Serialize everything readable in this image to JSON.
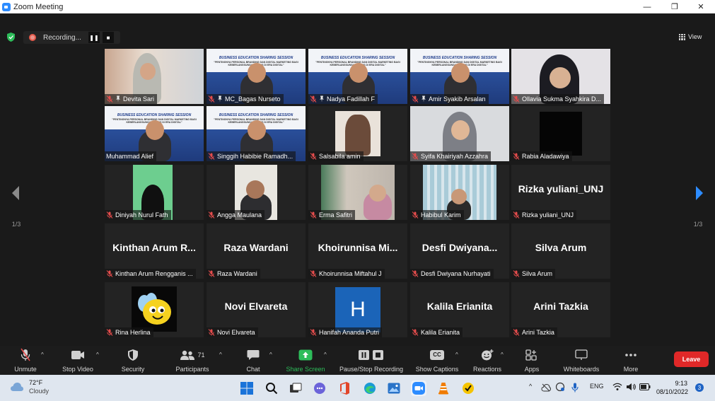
{
  "window": {
    "title": "Zoom Meeting",
    "controls": {
      "minimize": "—",
      "maximize": "❐",
      "close": "✕"
    }
  },
  "recording": {
    "status": "Recording...",
    "pause": "❚❚",
    "stop": "■"
  },
  "view_button": {
    "label": "View"
  },
  "pagination": {
    "left_label": "1/3",
    "right_label": "1/3"
  },
  "participants": [
    {
      "name": "Devita Sari",
      "display": "",
      "muted": true,
      "pinned": true,
      "video": "photo-hijab"
    },
    {
      "name": "MC_Bagas Nurseto",
      "display": "",
      "muted": true,
      "pinned": true,
      "video": "slide"
    },
    {
      "name": "Nadya Fadillah F",
      "display": "",
      "muted": true,
      "pinned": true,
      "video": "slide"
    },
    {
      "name": "Amir Syakib Arsalan",
      "display": "",
      "muted": true,
      "pinned": true,
      "video": "slide"
    },
    {
      "name": "Ollavia Sukma Syahkira D...",
      "display": "",
      "muted": true,
      "pinned": false,
      "video": "photo-hijab-black"
    },
    {
      "name": "Muhammad Alief",
      "display": "",
      "muted": false,
      "pinned": false,
      "video": "slide",
      "active": true
    },
    {
      "name": "Singgih Habibie Ramadh...",
      "display": "",
      "muted": true,
      "pinned": false,
      "video": "slide"
    },
    {
      "name": "Salsabila amin",
      "display": "",
      "muted": true,
      "pinned": false,
      "video": "anime"
    },
    {
      "name": "Syifa Khairiyah Azzahra",
      "display": "",
      "muted": true,
      "pinned": false,
      "video": "photo-hijab-grey"
    },
    {
      "name": "Rabia Aladawiya",
      "display": "",
      "muted": true,
      "pinned": false,
      "video": "black"
    },
    {
      "name": "Diniyah Nurul Fath",
      "display": "",
      "muted": true,
      "pinned": false,
      "video": "green"
    },
    {
      "name": "Angga Maulana",
      "display": "",
      "muted": true,
      "pinned": false,
      "video": "photo-boy"
    },
    {
      "name": "Erma Safitri",
      "display": "",
      "muted": true,
      "pinned": false,
      "video": "room"
    },
    {
      "name": "Habibul Karim",
      "display": "",
      "muted": true,
      "pinned": false,
      "video": "curtain"
    },
    {
      "name": "Rizka yuliani_UNJ",
      "display": "Rizka yuliani_UNJ",
      "muted": true,
      "pinned": false,
      "video": "none"
    },
    {
      "name": "Kinthan Arum Rengganis ...",
      "display": "Kinthan Arum R...",
      "muted": true,
      "pinned": false,
      "video": "none"
    },
    {
      "name": "Raza Wardani",
      "display": "Raza Wardani",
      "muted": true,
      "pinned": false,
      "video": "none"
    },
    {
      "name": "Khoirunnisa Miftahul J",
      "display": "Khoirunnisa Mi...",
      "muted": true,
      "pinned": false,
      "video": "none"
    },
    {
      "name": "Desfi Dwiyana Nurhayati",
      "display": "Desfi Dwiyana...",
      "muted": true,
      "pinned": false,
      "video": "none"
    },
    {
      "name": "Silva Arum",
      "display": "Silva Arum",
      "muted": true,
      "pinned": false,
      "video": "none"
    },
    {
      "name": "Rina Herlina",
      "display": "",
      "muted": true,
      "pinned": false,
      "video": "bee"
    },
    {
      "name": "Novi Elvareta",
      "display": "Novi Elvareta",
      "muted": true,
      "pinned": false,
      "video": "none"
    },
    {
      "name": "Hanifah Ananda Putri",
      "display": "",
      "muted": true,
      "pinned": false,
      "video": "letter-h",
      "letter": "H"
    },
    {
      "name": "Kalila Erianita",
      "display": "Kalila Erianita",
      "muted": true,
      "pinned": false,
      "video": "none"
    },
    {
      "name": "Arini Tazkia",
      "display": "Arini Tazkia",
      "muted": true,
      "pinned": false,
      "video": "none"
    }
  ],
  "slide": {
    "title": "BUSINESS EDUCATION SHARING SESSION",
    "subtitle": "\"PENTINGNYA PERSONAL BRANDING DAN DIGITAL MARKETING BAGI KEBERLANGSUNGAN BISNIS DI ERA DIGITAL\""
  },
  "toolbar": {
    "unmute": "Unmute",
    "stop_video": "Stop Video",
    "security": "Security",
    "participants": "Participants",
    "participants_count": "71",
    "chat": "Chat",
    "share_screen": "Share Screen",
    "pause_stop_recording": "Pause/Stop Recording",
    "show_captions": "Show Captions",
    "captions_glyph": "CC",
    "reactions": "Reactions",
    "apps": "Apps",
    "whiteboards": "Whiteboards",
    "more": "More",
    "leave": "Leave"
  },
  "taskbar": {
    "weather_temp": "72°F",
    "weather_condition": "Cloudy",
    "language": "ENG",
    "time": "9:13",
    "date": "08/10/2022",
    "notifications": "3",
    "tray_chevron": "^"
  },
  "colors": {
    "accent": "#2d8cff",
    "active_speaker": "#e8e84a",
    "leave": "#e02828",
    "share": "#2dbd5a",
    "muted_icon": "#e44c4c"
  }
}
